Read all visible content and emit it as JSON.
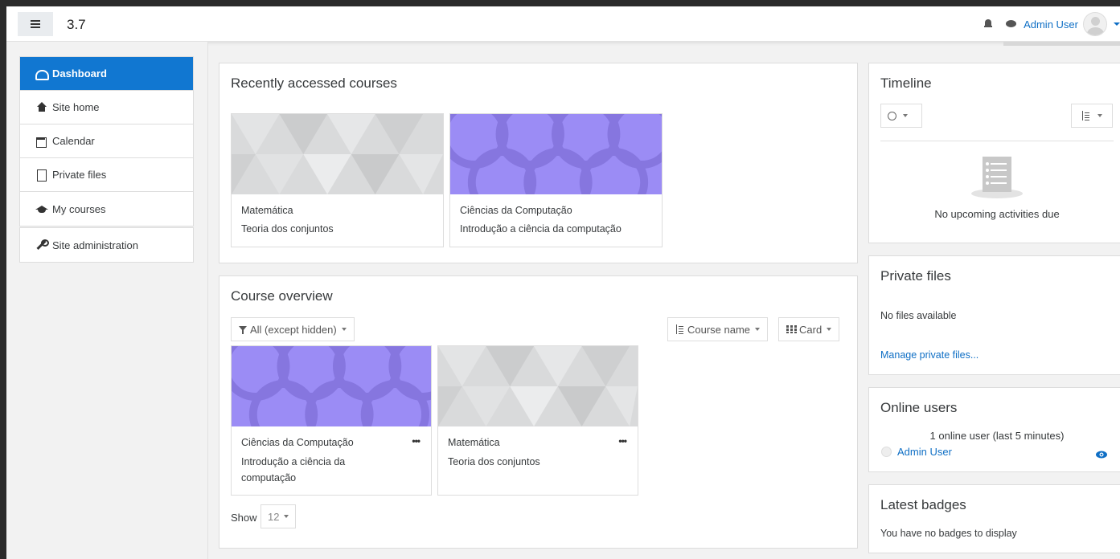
{
  "header": {
    "version": "3.7",
    "user_name": "Admin User"
  },
  "sidebar": {
    "items": [
      {
        "label": "Dashboard",
        "icon": "dashboard-icon",
        "active": true
      },
      {
        "label": "Site home",
        "icon": "home-icon"
      },
      {
        "label": "Calendar",
        "icon": "calendar-icon"
      },
      {
        "label": "Private files",
        "icon": "file-icon"
      },
      {
        "label": "My courses",
        "icon": "graduation-cap-icon"
      }
    ],
    "admin": {
      "label": "Site administration",
      "icon": "wrench-icon"
    }
  },
  "recent": {
    "title": "Recently accessed courses",
    "courses": [
      {
        "category": "Matemática",
        "name": "Teoria dos conjuntos",
        "pattern": "gray-triangles"
      },
      {
        "category": "Ciências da Computação",
        "name": "Introdução a ciência da computação",
        "pattern": "purple-circles"
      }
    ]
  },
  "overview": {
    "title": "Course overview",
    "filter_label": "All (except hidden)",
    "sort_label": "Course name",
    "view_label": "Card",
    "courses": [
      {
        "category": "Ciências da Computação",
        "name_line1": "Introdução a ciência da",
        "name_line2": "computação",
        "menu": "•••",
        "pattern": "purple-circles"
      },
      {
        "category": "Matemática",
        "name_line1": "Teoria dos conjuntos",
        "name_line2": "",
        "menu": "•••",
        "pattern": "gray-triangles"
      }
    ],
    "show_label": "Show",
    "show_value": "12"
  },
  "timeline": {
    "title": "Timeline",
    "empty_text": "No upcoming activities due"
  },
  "private_files": {
    "title": "Private files",
    "empty_text": "No files available",
    "manage_link": "Manage private files..."
  },
  "online_users": {
    "title": "Online users",
    "summary": "1 online user (last 5 minutes)",
    "user": "Admin User"
  },
  "badges": {
    "title": "Latest badges",
    "empty_text": "You have no badges to display"
  },
  "colors": {
    "accent": "#1177d1",
    "link": "#0f6fc5",
    "purple_pattern": "#9b8cf5",
    "gray_pattern": "#d9dadb"
  }
}
